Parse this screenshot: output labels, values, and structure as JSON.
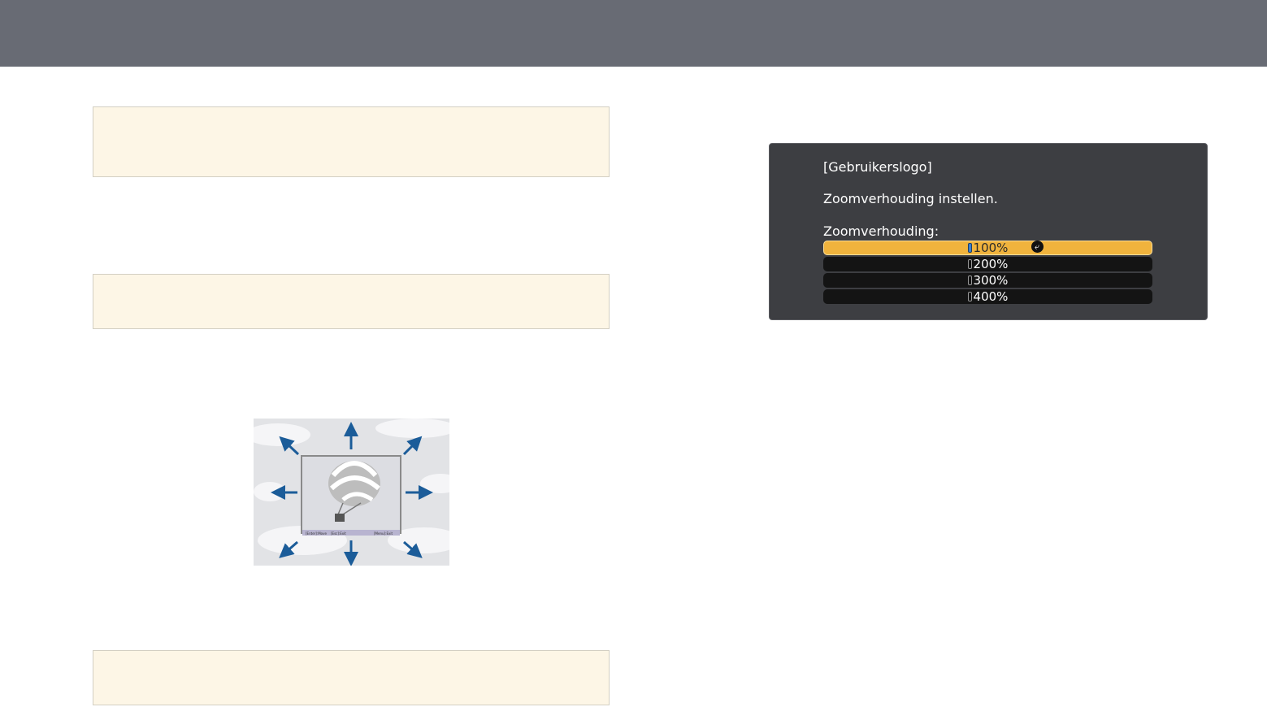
{
  "osd": {
    "title": "[Gebruikerslogo]",
    "message": "Zoomverhouding instellen.",
    "label": "Zoomverhouding:",
    "options": [
      {
        "label": "100%",
        "selected": true
      },
      {
        "label": "200%",
        "selected": false
      },
      {
        "label": "300%",
        "selected": false
      },
      {
        "label": "400%",
        "selected": false
      }
    ],
    "selected_color": "#f0b33d"
  },
  "illustration": {
    "icon": "hot-air-balloon-icon",
    "arrow_color": "#1b5c99",
    "status_bar_texts": [
      "[Enter]:Move",
      "[Esc]:Exit",
      "[Menu]:Exit"
    ]
  },
  "colors": {
    "header": "#686b74",
    "note_background": "#fdf6e6",
    "osd_background": "#3d3e42"
  }
}
